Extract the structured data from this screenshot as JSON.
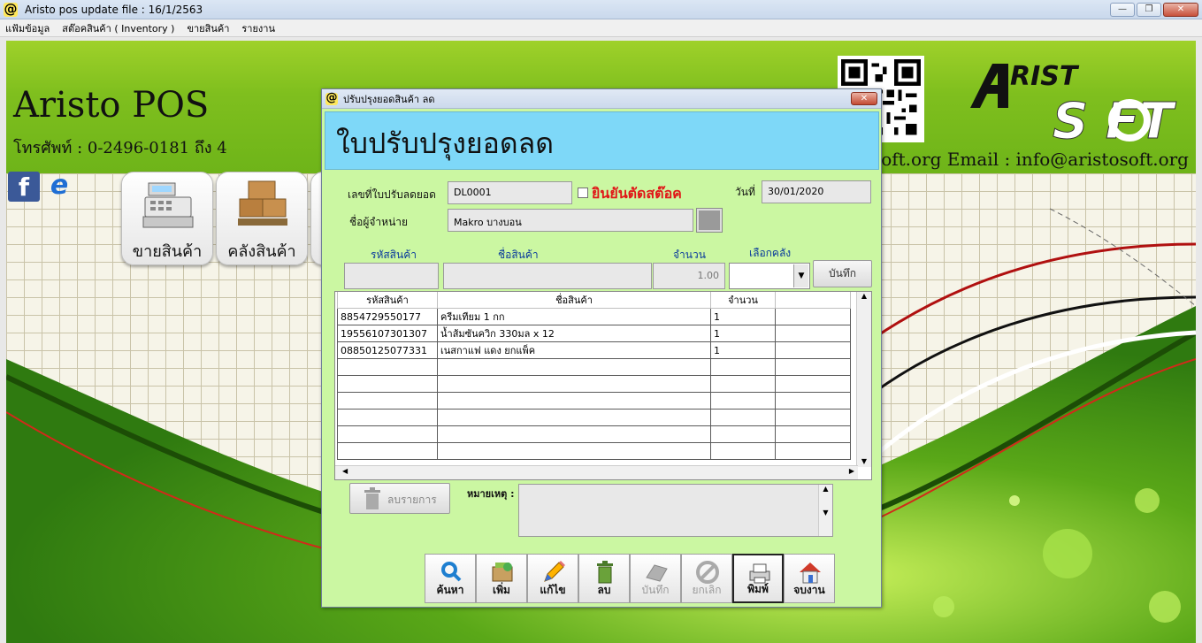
{
  "window": {
    "title": "Aristo pos  update file : 16/1/2563"
  },
  "menu": [
    "แฟ้มข้อมูล",
    "สต๊อคสินค้า ( Inventory )",
    "ขายสินค้า",
    "รายงาน"
  ],
  "desktop": {
    "brand": "Aristo POS",
    "phone": "โทรศัพท์ : 0-2496-0181 ถึง 4",
    "email": "aristosoft.org   Email : info@aristosoft.org",
    "logo_top": "RIST",
    "logo_bottom": "S   FT",
    "tiles": [
      {
        "label": "ขายสินค้า"
      },
      {
        "label": "คลังสินค้า"
      }
    ]
  },
  "dialog": {
    "title": "ปรับปรุงยอดสินค้า ลด",
    "banner": "ใบปรับปรุงยอดลด",
    "doc_no_label": "เลขที่ใบปรับลดยอด",
    "doc_no": "DL0001",
    "confirm_label": "ยินยันตัดสต๊อค",
    "date_label": "วันที่",
    "date": "30/01/2020",
    "vendor_label": "ชื่อผู้จำหน่าย",
    "vendor": "Makro บางบอน",
    "entry": {
      "code_label": "รหัสสินค้า",
      "name_label": "ชื่อสินค้า",
      "qty_label": "จำนวน",
      "wh_label": "เลือกคลัง",
      "qty_value": "1.00",
      "save_label": "บันทึก"
    },
    "grid": {
      "headers": [
        "รหัสสินค้า",
        "ชื่อสินค้า",
        "จำนวน",
        ""
      ],
      "rows": [
        [
          "8854729550177",
          "ครีมเทียม 1 กก",
          "1",
          ""
        ],
        [
          "19556107301307",
          "น้ำส้มซันควิก 330มล x 12",
          "1",
          ""
        ],
        [
          "08850125077331",
          "เนสกาแฟ แดง ยกแพ็ค",
          "1",
          ""
        ]
      ]
    },
    "delete_item_label": "ลบรายการ",
    "remark_label": "หมายเหตุ :",
    "toolbar": [
      {
        "label": "ค้นหา",
        "icon": "search-icon"
      },
      {
        "label": "เพิ่ม",
        "icon": "add-icon"
      },
      {
        "label": "แก้ไข",
        "icon": "pencil-icon"
      },
      {
        "label": "ลบ",
        "icon": "trash-icon"
      },
      {
        "label": "บันทึก",
        "icon": "save-icon"
      },
      {
        "label": "ยกเลิก",
        "icon": "cancel-icon"
      },
      {
        "label": "พิมพ์",
        "icon": "printer-icon"
      },
      {
        "label": "จบงาน",
        "icon": "home-icon"
      }
    ]
  }
}
